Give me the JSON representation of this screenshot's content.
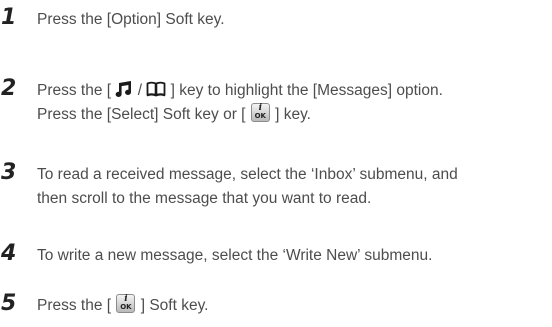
{
  "steps": [
    {
      "number": "1",
      "lines": [
        {
          "text": "Press the [Option] Soft key."
        }
      ]
    },
    {
      "number": "2",
      "lines": [
        {
          "before": "Press the [ ",
          "sep": " / ",
          "after": " ] key to highlight the [Messages] option."
        },
        {
          "before": "Press the [Select] Soft key or [ ",
          "after": " ] key."
        }
      ]
    },
    {
      "number": "3",
      "lines": [
        {
          "text": "To read a received message, select the ‘Inbox’ submenu, and"
        },
        {
          "text": "then scroll to the message that you want to read."
        }
      ]
    },
    {
      "number": "4",
      "lines": [
        {
          "text": "To write a new message, select the ‘Write New’ submenu."
        }
      ]
    },
    {
      "number": "5",
      "lines": [
        {
          "before": "Press the [ ",
          "after": " ] Soft key."
        }
      ]
    }
  ],
  "icons": {
    "music": "music-note-icon",
    "book": "open-book-icon",
    "ok_key": "info-ok-key-icon",
    "ok_key_top": "i",
    "ok_key_bottom": "OK"
  }
}
